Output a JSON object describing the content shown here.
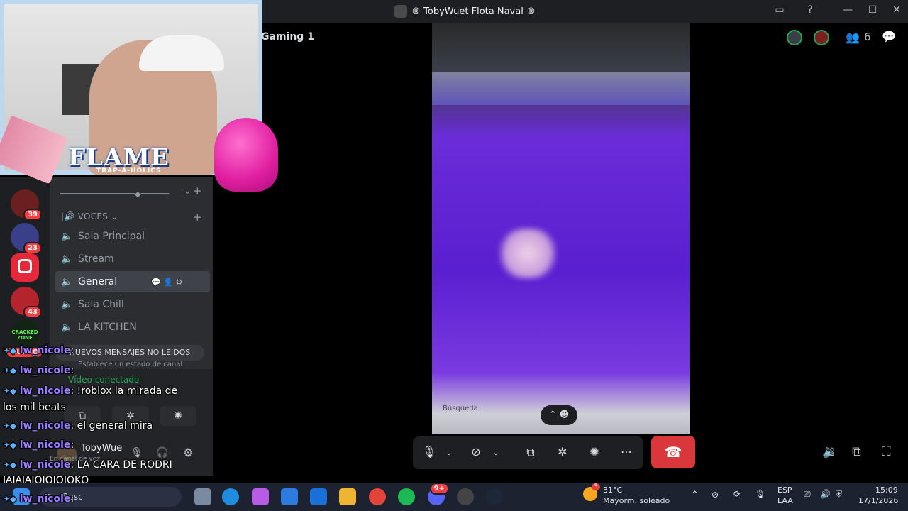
{
  "window": {
    "title": "® TobyWuet Flota Naval ®",
    "buttons": {
      "inbox": "▭",
      "help": "?",
      "minimize": "—",
      "maximize": "☐",
      "close": "✕"
    }
  },
  "overlay": {
    "brand": "FLAME",
    "brand_sub": "TRAP-A-HOLICS"
  },
  "main": {
    "channel_title": "Gaming 1",
    "participant_count": "6",
    "stream_search_label": "Búsqueda"
  },
  "servers": [
    {
      "badge": "39"
    },
    {
      "badge": "23"
    },
    {
      "badge": ""
    },
    {
      "badge": "43"
    },
    {
      "label": "CRACKED ZONE"
    }
  ],
  "channel_list": {
    "separator": "━━━━━━━━━━━━━━━━◆━━━━━━",
    "category": "VOCES",
    "channels": [
      {
        "name": "Sala Principal",
        "active": false
      },
      {
        "name": "Stream",
        "active": false
      },
      {
        "name": "General",
        "active": true
      },
      {
        "name": "Sala Chill",
        "active": false
      },
      {
        "name": "LA KITCHEN",
        "active": false
      }
    ],
    "new_badge": "NUEVO",
    "unread_banner": "NUEVOS MENSAJES NO LEÍDOS"
  },
  "voice_panel": {
    "status": "Vídeo conectado",
    "status_hint": "Establece un estado de canal",
    "user_name": "TobyWue",
    "user_status": "En canal de voz"
  },
  "chat_overlay": [
    {
      "user": "lw_nicole",
      "text": ""
    },
    {
      "user": "lw_nicole",
      "text": ""
    },
    {
      "user": "lw_nicole",
      "text": "!roblox la mirada de"
    },
    {
      "user": "",
      "text": "los mil beats"
    },
    {
      "user": "lw_nicole",
      "text": "el general mira"
    },
    {
      "user": "lw_nicole",
      "text": ""
    },
    {
      "user": "lw_nicole",
      "text": "LA CARA DE RODRI"
    },
    {
      "user": "",
      "text": "JAJAJAJQJQJQJQKQ"
    },
    {
      "user": "lw_nicole",
      "text": ""
    }
  ],
  "taskbar": {
    "search_placeholder": "Busc",
    "weather_temp": "31°C",
    "weather_desc": "Mayorm. soleado",
    "weather_badge": "3",
    "lang_line1": "ESP",
    "lang_line2": "LAA",
    "time": "15:09",
    "date": "17/1/2026",
    "discord_badge": "9+"
  },
  "colors": {
    "accent_red": "#da373c",
    "chat_user": "#9b7bff",
    "stream_purple": "#5a1fd0",
    "online_green": "#23a55a"
  }
}
